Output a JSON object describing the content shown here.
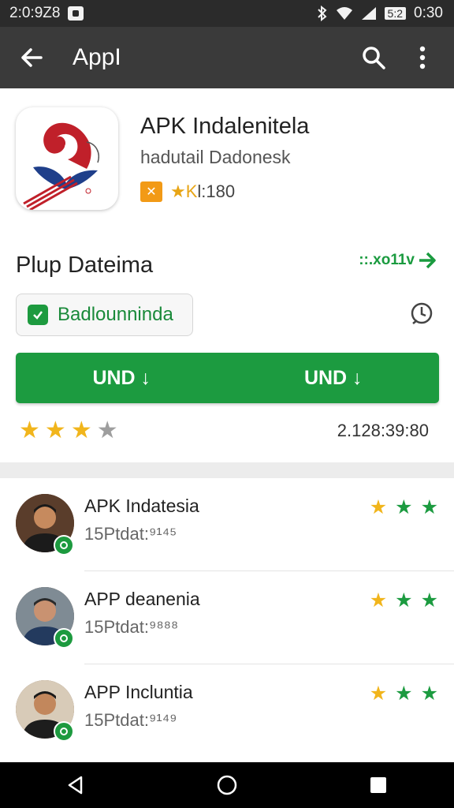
{
  "status_bar": {
    "time_left": "2:0:9Z8",
    "battery_text": "5:2",
    "time_right": "0:30"
  },
  "app_bar": {
    "title": "AppI"
  },
  "app": {
    "title": "APK Indalenitela",
    "developer": "hadutail Dadonesk",
    "badge_text": "✕",
    "meta_stars": "★K",
    "meta_value": "l:180"
  },
  "section": {
    "title": "Plup Dateima",
    "more_label": "::.xo11v"
  },
  "chip": {
    "label": "Badlounninda"
  },
  "install": {
    "left_label": "UND ↓",
    "right_label": "UND ↓"
  },
  "rating": {
    "value": 3,
    "max": 4,
    "count": "2.128:39:80"
  },
  "reviews": [
    {
      "name": "APK Indatesia",
      "sub": "15Ptdat:⁹¹⁴⁵",
      "stars": [
        "★",
        "★",
        "★"
      ]
    },
    {
      "name": "APP deanenia",
      "sub": "15Ptdat:⁹⁸⁸⁸",
      "stars": [
        "★",
        "★",
        "★"
      ]
    },
    {
      "name": "APP Incluntia",
      "sub": "15Ptdat:⁹¹⁴⁹",
      "stars": [
        "★",
        "★",
        "★"
      ]
    }
  ],
  "colors": {
    "accent_green": "#1c9b40",
    "star_yellow": "#f1b51c",
    "app_bar": "#3a3a3a"
  },
  "icons": [
    "arrow-back-icon",
    "search-icon",
    "more-vert-icon",
    "share-icon",
    "arrow-forward-icon",
    "nav-back-icon",
    "nav-home-icon",
    "nav-recents-icon"
  ]
}
